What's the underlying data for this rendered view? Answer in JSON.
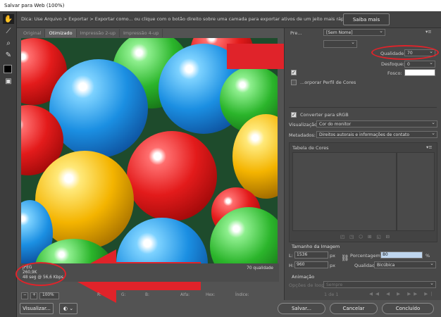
{
  "window": {
    "title": "Salvar para Web (100%)"
  },
  "tipbar": {
    "text": "Dica: Use Arquivo > Exportar > Exportar como... ou clique com o botão direito sobre uma camada para exportar ativos de um jeito mais rápido",
    "learn_more": "Saiba mais"
  },
  "tools": [
    "hand-icon",
    "slice-select-icon",
    "zoom-icon",
    "eyedropper-icon",
    "color-swatch",
    "toggle-slices-icon"
  ],
  "tabs": [
    {
      "label": "Original"
    },
    {
      "label": "Otimizado",
      "active": true
    },
    {
      "label": "Impressão 2-up"
    },
    {
      "label": "Impressão 4-up"
    }
  ],
  "image_info": {
    "format": "JPEG",
    "size": "260,9K",
    "time": "48 seg @ 56,6 Kbps",
    "quality": "70 qualidade"
  },
  "bottom": {
    "zoom": "100%",
    "r": "R:",
    "g": "G:",
    "b": "B:",
    "alpha": "Alfa:",
    "hex": "Hex:",
    "index": "Índice:"
  },
  "buttons": {
    "preview": "Visualizar...",
    "save": "Salvar...",
    "cancel": "Cancelar",
    "done": "Concluído"
  },
  "panel": {
    "preset_label": "Pre...",
    "preset_value": "[Sem Nome]",
    "quality_label": "Qualidade:",
    "quality_value": "70",
    "blur_label": "Desfoque:",
    "blur_value": "0",
    "matte_label": "Fosco:",
    "embed_profile": "...orporar Perfil de Cores",
    "convert_srgb": "Converter para sRGB",
    "preview_label": "Visualização:",
    "preview_value": "Cor do monitor",
    "metadata_label": "Metadados:",
    "metadata_value": "Direitos autorais e informações de contato",
    "color_table": "Tabela de Cores",
    "image_size": "Tamanho da Imagem",
    "width_label": "L:",
    "width_value": "1536",
    "height_label": "H:",
    "height_value": "960",
    "unit": "px",
    "percent_label": "Porcentagem:",
    "percent_value": "80",
    "percent_unit": "%",
    "resample_label": "Qualidade:",
    "resample_value": "Bicúbica",
    "animation": "Animação",
    "loop_label": "Opções de loop:",
    "loop_value": "Sempre",
    "frame_counter": "1 de 1"
  },
  "colors": {
    "annotation_red": "#e0232a",
    "panel_bg": "#484848"
  }
}
